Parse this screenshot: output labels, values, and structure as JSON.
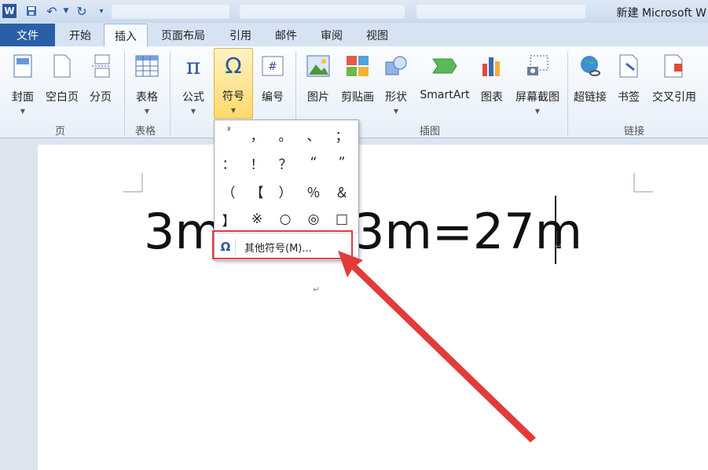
{
  "title_bar": {
    "window_title": "新建 Microsoft W",
    "app_logo": "W"
  },
  "menu_tabs": [
    {
      "label": "文件"
    },
    {
      "label": "开始"
    },
    {
      "label": "插入"
    },
    {
      "label": "页面布局"
    },
    {
      "label": "引用"
    },
    {
      "label": "邮件"
    },
    {
      "label": "审阅"
    },
    {
      "label": "视图"
    }
  ],
  "ribbon": {
    "buttons": {
      "cover": "封面",
      "blank_page": "空白页",
      "page_break": "分页",
      "table": "表格",
      "equation": "公式",
      "symbol": "符号",
      "numbering": "编号",
      "picture": "图片",
      "clipart": "剪贴画",
      "shapes": "形状",
      "smartart": "SmartArt",
      "chart": "图表",
      "screenshot": "屏幕截图",
      "hyperlink": "超链接",
      "bookmark": "书签",
      "cross_ref": "交叉引用"
    },
    "groups": {
      "pages": "页",
      "tables": "表格",
      "illustrations": "插图",
      "links": "链接"
    }
  },
  "symbol_menu": {
    "symbols": [
      "³",
      "，",
      "。",
      "、",
      "；",
      "：",
      "！",
      "？",
      "“",
      "”",
      "（",
      "【",
      "）",
      "％",
      "＆",
      "】",
      "※",
      "○",
      "◎",
      "□"
    ],
    "more_label": "其他符号(M)..."
  },
  "document": {
    "text_left": "3m",
    "text_right": "3m=27m"
  },
  "colors": {
    "accent": "#2b579a",
    "highlight": "#e23b3b"
  }
}
